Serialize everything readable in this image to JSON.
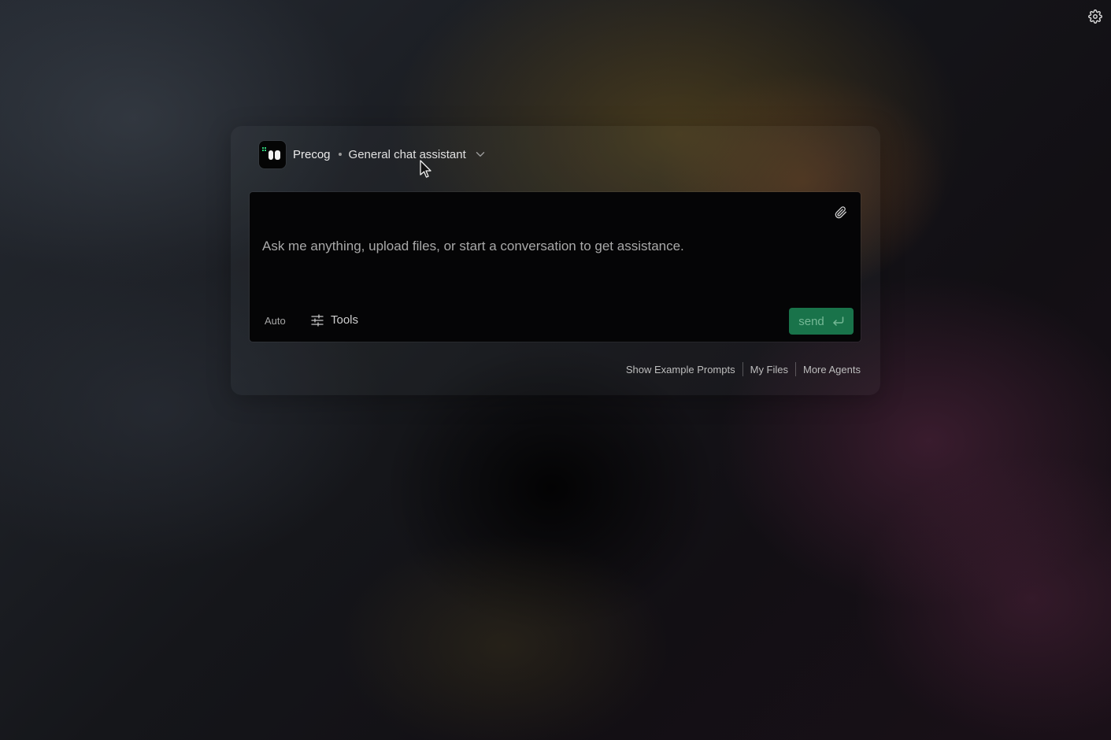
{
  "settings": {
    "icon": "gear-icon"
  },
  "agent": {
    "name": "Precog",
    "separator": "•",
    "description": "General chat assistant",
    "dropdown_icon": "chevron-down-icon"
  },
  "composer": {
    "placeholder": "Ask me anything, upload files, or start a conversation to get assistance.",
    "value": "",
    "attach_icon": "paperclip-icon",
    "model_label": "Auto",
    "tools_label": "Tools",
    "tools_icon": "sliders-icon",
    "send_label": "send",
    "send_icon": "enter-key-icon"
  },
  "footer": {
    "links": [
      "Show Example Prompts",
      "My Files",
      "More Agents"
    ]
  },
  "colors": {
    "send_bg": "#19734a",
    "send_text": "#74b895",
    "composer_bg": "#050506",
    "accent_dots": "#2fd07a"
  }
}
